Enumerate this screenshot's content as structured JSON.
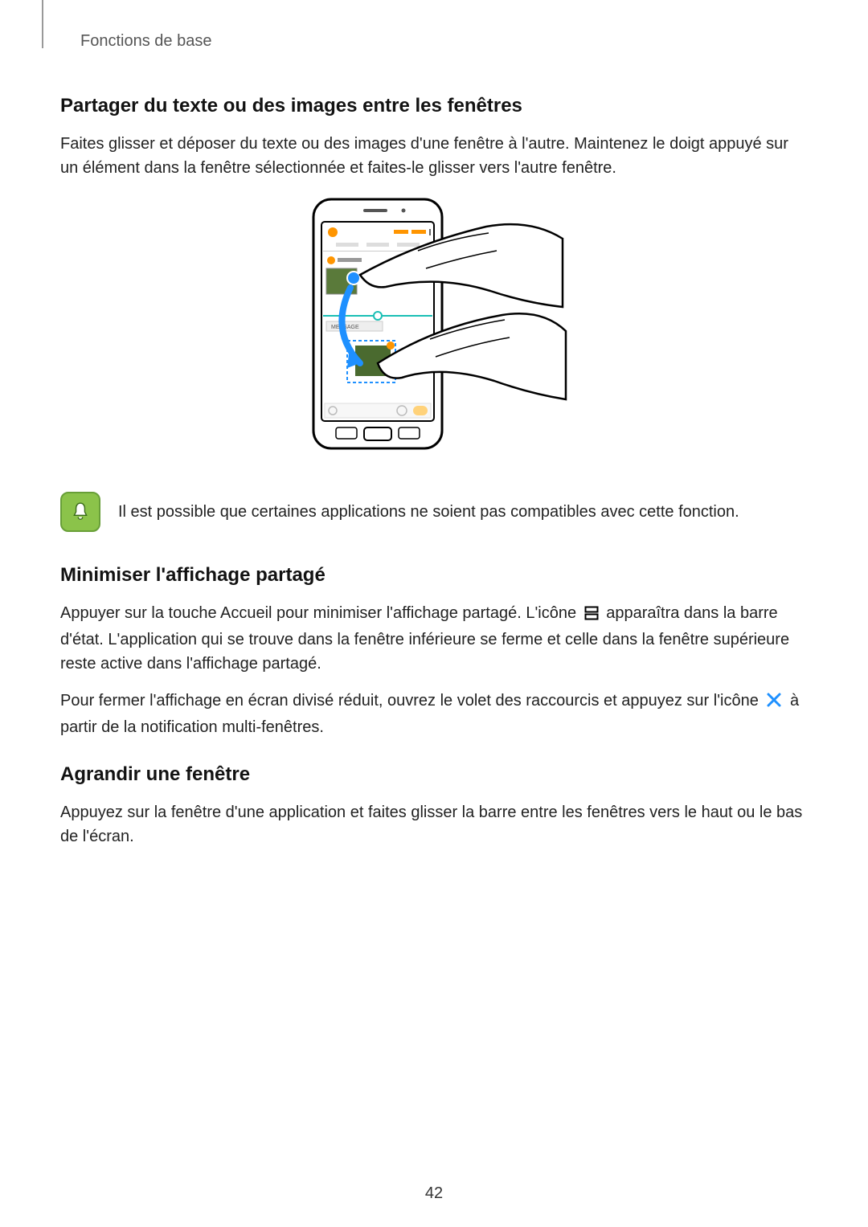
{
  "breadcrumb": "Fonctions de base",
  "section1": {
    "heading": "Partager du texte ou des images entre les fenêtres",
    "p1": "Faites glisser et déposer du texte ou des images d'une fenêtre à l'autre. Maintenez le doigt appuyé sur un élément dans la fenêtre sélectionnée et faites-le glisser vers l'autre fenêtre."
  },
  "note1": "Il est possible que certaines applications ne soient pas compatibles avec cette fonction.",
  "section2": {
    "heading": "Minimiser l'affichage partagé",
    "p1a": "Appuyer sur la touche Accueil pour minimiser l'affichage partagé. L'icône ",
    "p1b": " apparaîtra dans la barre d'état. L'application qui se trouve dans la fenêtre inférieure se ferme et celle dans la fenêtre supérieure reste active dans l'affichage partagé.",
    "p2a": "Pour fermer l'affichage en écran divisé réduit, ouvrez le volet des raccourcis et appuyez sur l'icône ",
    "p2b": " à partir de la notification multi-fenêtres."
  },
  "section3": {
    "heading": "Agrandir une fenêtre",
    "p1": "Appuyez sur la fenêtre d'une application et faites glisser la barre entre les fenêtres vers le haut ou le bas de l'écran."
  },
  "figure": {
    "upper_label": "MESSAGE"
  },
  "page_number": "42"
}
